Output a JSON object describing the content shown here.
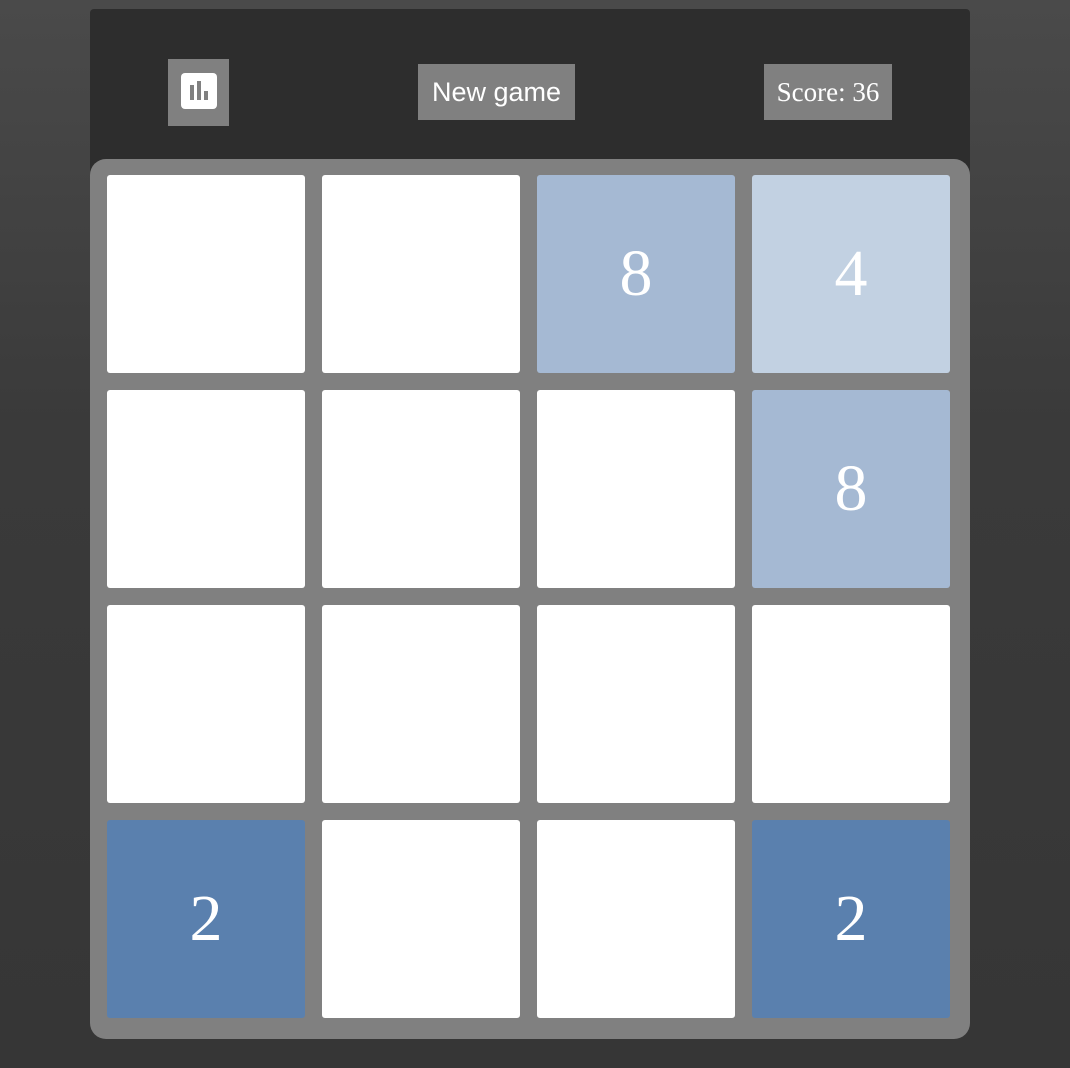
{
  "header": {
    "stats_icon": "bar-chart-icon",
    "new_game_label": "New game",
    "score_label": "Score:",
    "score_value": "36",
    "score_text": "Score: 36"
  },
  "board": {
    "size": 4,
    "rows": [
      [
        "",
        "",
        "8",
        "4"
      ],
      [
        "",
        "",
        "",
        "8"
      ],
      [
        "",
        "",
        "",
        ""
      ],
      [
        "2",
        "",
        "",
        "2"
      ]
    ]
  },
  "colors": {
    "background": "#3a3a3a",
    "header": "#2d2d2d",
    "board": "#808080",
    "button": "#808080",
    "empty_tile": "#ffffff",
    "tile_2": "#5a80ae",
    "tile_4": "#c2d1e2",
    "tile_8": "#a5b9d3",
    "tile_text": "#ffffff"
  }
}
